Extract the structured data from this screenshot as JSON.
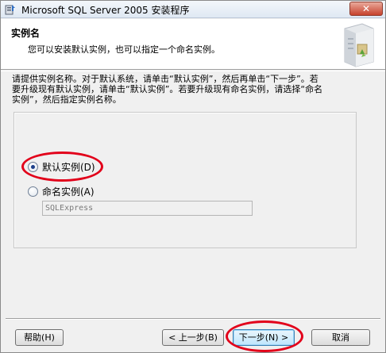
{
  "window": {
    "title": "Microsoft SQL Server 2005 安装程序",
    "close_glyph": "✕"
  },
  "header": {
    "title": "实例名",
    "subtitle": "您可以安装默认实例，也可以指定一个命名实例。"
  },
  "instructions": {
    "line1": "请提供实例名称。对于默认系统，请单击“默认实例”，然后再单击“下一步”。若",
    "line2": "要升级现有默认实例，请单击“默认实例”。若要升级现有命名实例，请选择“命名",
    "line3": "实例”，然后指定实例名称。"
  },
  "options": {
    "default_instance": {
      "label": "默认实例(D)",
      "selected": true
    },
    "named_instance": {
      "label": "命名实例(A)",
      "selected": false
    },
    "instance_name_value": "SQLExpress"
  },
  "buttons": {
    "help": "帮助(H)",
    "back": "< 上一步(B)",
    "next": "下一步(N) >",
    "cancel": "取消"
  },
  "annotations": {
    "highlight_color": "#e2001a"
  },
  "icons": {
    "app": "setup-icon",
    "header": "server-box-icon"
  }
}
